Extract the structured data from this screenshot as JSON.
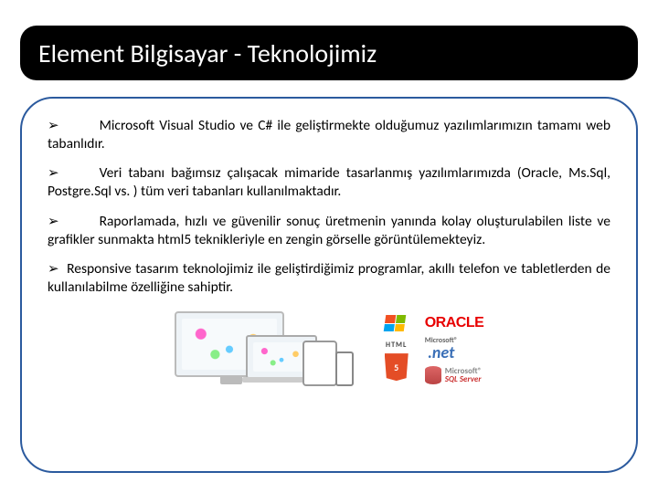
{
  "title": "Element  Bilgisayar - Teknolojimiz",
  "bullets": [
    "Microsoft Visual Studio ve C# ile geliştirmekte olduğumuz yazılımlarımızın tamamı web tabanlıdır.",
    "Veri tabanı bağımsız çalışacak mimaride tasarlanmış yazılımlarımızda (Oracle, Ms.Sql, Postgre.Sql vs. ) tüm veri tabanları kullanılmaktadır.",
    "Raporlamada, hızlı ve güvenilir sonuç üretmenin yanında kolay oluşturulabilen liste ve grafikler sunmakta  html5 teknikleriyle en zengin görselle görüntülemekteyiz.",
    "Responsive tasarım teknolojimiz ile geliştirdiğimiz programlar, akıllı telefon ve tabletlerden de kullanılabilme özelliğine sahiptir."
  ],
  "logos": {
    "oracle": "ORACLE",
    "html5_top": "HTML",
    "html5_badge": "5",
    "dotnet_top": "Microsoft®",
    "dotnet_main": ".net",
    "sql_top": "Microsoft®",
    "sql_bot": "SQL Server"
  }
}
